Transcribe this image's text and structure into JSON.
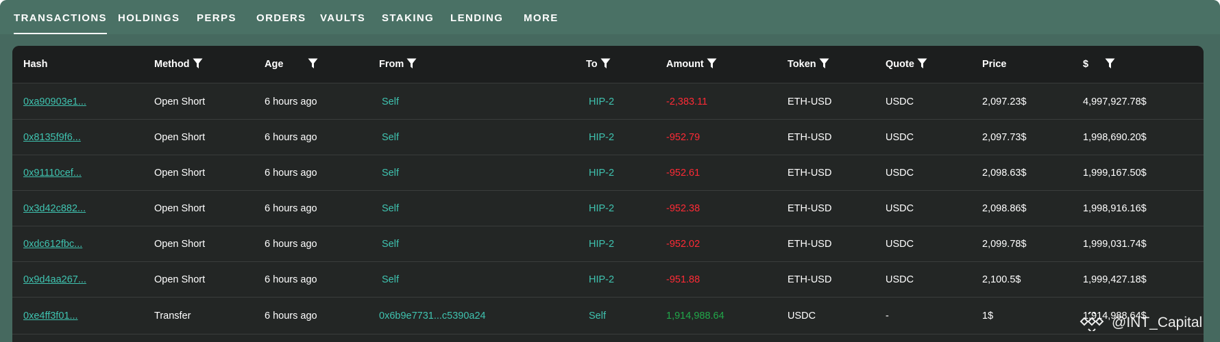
{
  "tabs": [
    {
      "label": "TRANSACTIONS",
      "active": true
    },
    {
      "label": "HOLDINGS",
      "active": false
    },
    {
      "label": "PERPS",
      "active": false
    },
    {
      "label": "ORDERS",
      "active": false
    },
    {
      "label": "VAULTS",
      "active": false
    },
    {
      "label": "STAKING",
      "active": false
    },
    {
      "label": "LENDING",
      "active": false
    },
    {
      "label": "MORE",
      "active": false
    }
  ],
  "columns": [
    {
      "key": "hash",
      "label": "Hash",
      "filter": false
    },
    {
      "key": "method",
      "label": "Method",
      "filter": true
    },
    {
      "key": "age",
      "label": "Age",
      "filter": true
    },
    {
      "key": "from",
      "label": "From",
      "filter": true
    },
    {
      "key": "to",
      "label": "To",
      "filter": true
    },
    {
      "key": "amount",
      "label": "Amount",
      "filter": true
    },
    {
      "key": "token",
      "label": "Token",
      "filter": true
    },
    {
      "key": "quote",
      "label": "Quote",
      "filter": true
    },
    {
      "key": "price",
      "label": "Price",
      "filter": false
    },
    {
      "key": "usd",
      "label": "$",
      "filter": true
    }
  ],
  "rows": [
    {
      "hash": "0xa90903e1...",
      "method": "Open Short",
      "age": "6 hours ago",
      "from": "Self",
      "to": "HIP-2",
      "amount": "-2,383.11",
      "amount_sign": "negative",
      "token": "ETH-USD",
      "quote": "USDC",
      "price": "2,097.23$",
      "usd": "4,997,927.78$"
    },
    {
      "hash": "0x8135f9f6...",
      "method": "Open Short",
      "age": "6 hours ago",
      "from": "Self",
      "to": "HIP-2",
      "amount": "-952.79",
      "amount_sign": "negative",
      "token": "ETH-USD",
      "quote": "USDC",
      "price": "2,097.73$",
      "usd": "1,998,690.20$"
    },
    {
      "hash": "0x91110cef...",
      "method": "Open Short",
      "age": "6 hours ago",
      "from": "Self",
      "to": "HIP-2",
      "amount": "-952.61",
      "amount_sign": "negative",
      "token": "ETH-USD",
      "quote": "USDC",
      "price": "2,098.63$",
      "usd": "1,999,167.50$"
    },
    {
      "hash": "0x3d42c882...",
      "method": "Open Short",
      "age": "6 hours ago",
      "from": "Self",
      "to": "HIP-2",
      "amount": "-952.38",
      "amount_sign": "negative",
      "token": "ETH-USD",
      "quote": "USDC",
      "price": "2,098.86$",
      "usd": "1,998,916.16$"
    },
    {
      "hash": "0xdc612fbc...",
      "method": "Open Short",
      "age": "6 hours ago",
      "from": "Self",
      "to": "HIP-2",
      "amount": "-952.02",
      "amount_sign": "negative",
      "token": "ETH-USD",
      "quote": "USDC",
      "price": "2,099.78$",
      "usd": "1,999,031.74$"
    },
    {
      "hash": "0x9d4aa267...",
      "method": "Open Short",
      "age": "6 hours ago",
      "from": "Self",
      "to": "HIP-2",
      "amount": "-951.88",
      "amount_sign": "negative",
      "token": "ETH-USD",
      "quote": "USDC",
      "price": "2,100.5$",
      "usd": "1,999,427.18$"
    },
    {
      "hash": "0xe4ff3f01...",
      "method": "Transfer",
      "age": "6 hours ago",
      "from": "0x6b9e7731...c5390a24",
      "to": "Self",
      "amount": "1,914,988.64",
      "amount_sign": "positive",
      "token": "USDC",
      "quote": "-",
      "price": "1$",
      "usd": "1,914,988.64$"
    }
  ],
  "watermark": {
    "text": "@INT_Capital",
    "icon": "binance-logo-icon"
  },
  "colors": {
    "tab_bar": "#4a7165",
    "panel": "#232625",
    "header": "#1c1e1e",
    "link": "#3fc3b0",
    "negative": "#ff2a35",
    "positive": "#21a84a"
  }
}
